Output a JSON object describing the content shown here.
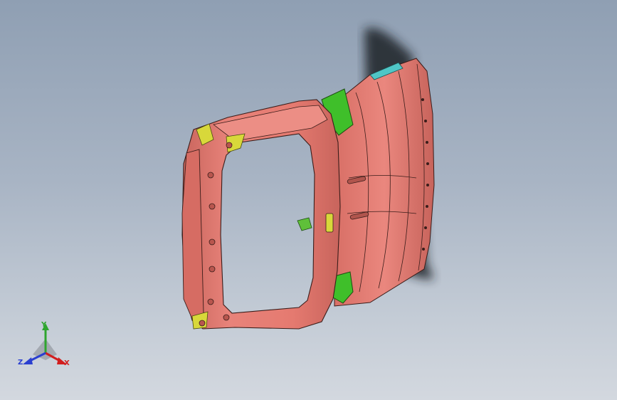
{
  "viewport": {
    "background_top": "#8f9fb3",
    "background_bottom": "#d3d8df"
  },
  "model": {
    "body_color": "#e57a70",
    "edge_color": "#3a1d1a",
    "bracket_green": "#3fbf2a",
    "bracket_yellow": "#d8d83a"
  },
  "triad": {
    "x_label": "X",
    "y_label": "Y",
    "z_label": "Z",
    "x_color": "#d21e1e",
    "y_color": "#2ea52e",
    "z_color": "#2a3fd0"
  }
}
